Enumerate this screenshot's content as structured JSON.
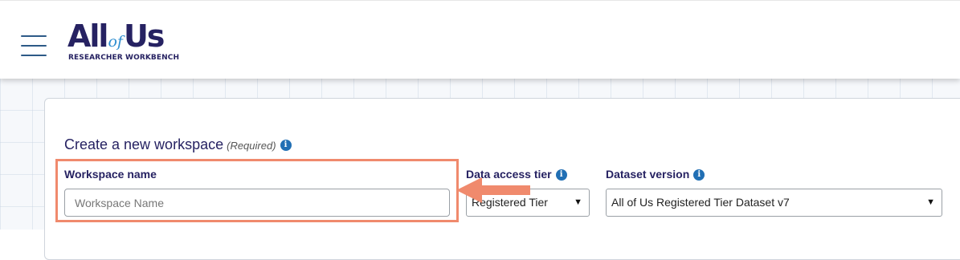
{
  "header": {
    "logo": {
      "all": "All",
      "of": "of",
      "us": "Us",
      "subtitle": "RESEARCHER WORKBENCH"
    },
    "menu_icon": "hamburger-icon"
  },
  "form": {
    "title": "Create a new workspace",
    "required_note": "(Required)",
    "workspace_name": {
      "label": "Workspace name",
      "value": "",
      "placeholder": "Workspace Name"
    },
    "data_access_tier": {
      "label": "Data access tier",
      "selected": "Registered Tier"
    },
    "dataset_version": {
      "label": "Dataset version",
      "selected": "All of Us Registered Tier Dataset v7"
    }
  },
  "colors": {
    "brand_navy": "#262262",
    "info_blue": "#216fb4",
    "annotation_orange": "#f08a6d"
  },
  "annotation": {
    "type": "highlight-with-arrow",
    "target": "workspace-name-field"
  }
}
